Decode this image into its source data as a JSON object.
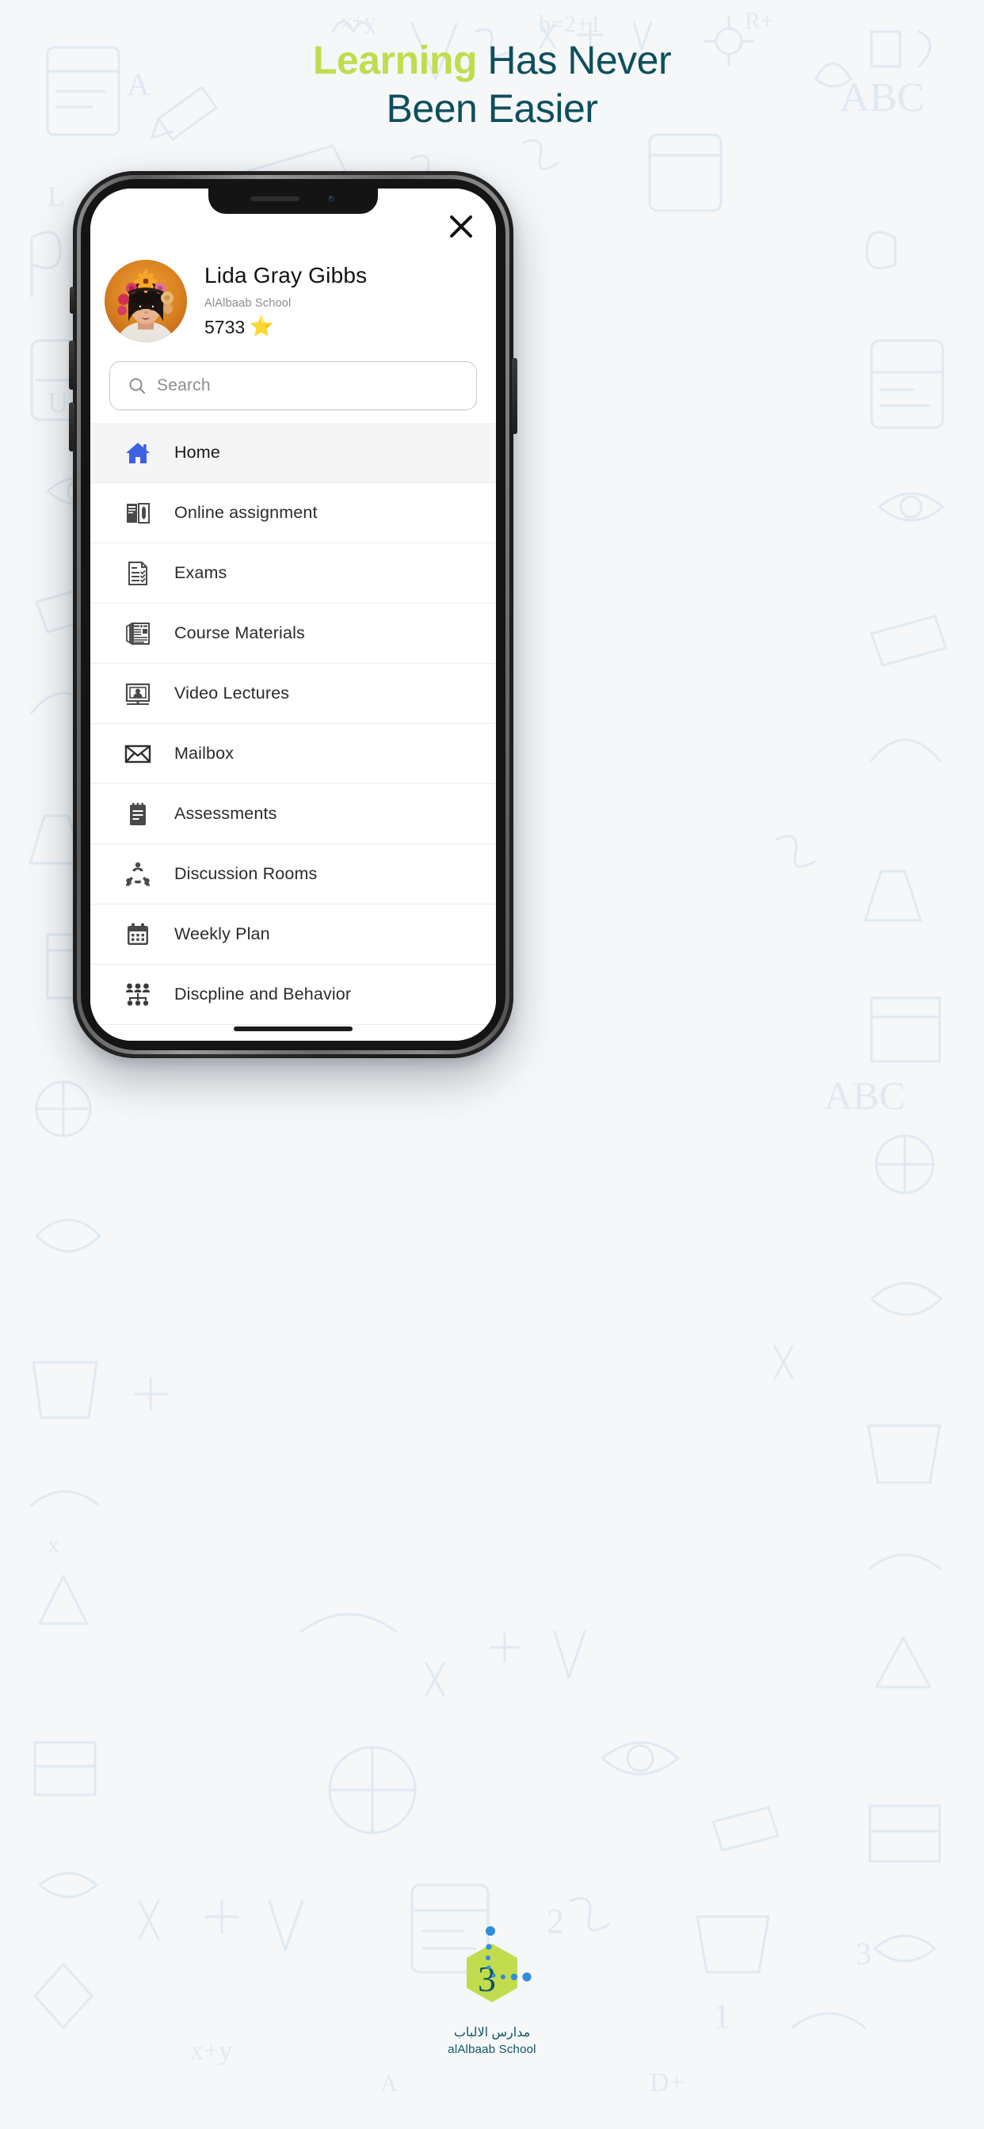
{
  "headline": {
    "accent_word": "Learning",
    "rest_line1": " Has Never",
    "line2": "Been Easier",
    "accent_color": "#c2dc4e",
    "text_color": "#0e4f5c"
  },
  "phone": {
    "close_icon": "close-icon"
  },
  "profile": {
    "name": "Lida Gray Gibbs",
    "school": "AlAlbaab School",
    "points": "5733",
    "star": "⭐",
    "avatar_alt": "user-avatar"
  },
  "search": {
    "placeholder": "Search",
    "icon": "search-icon"
  },
  "menu": {
    "items": [
      {
        "label": "Home",
        "icon": "home-icon",
        "active": true
      },
      {
        "label": "Online assignment",
        "icon": "assignment-book-icon",
        "active": false
      },
      {
        "label": "Exams",
        "icon": "exam-checklist-icon",
        "active": false
      },
      {
        "label": "Course Materials",
        "icon": "newspaper-icon",
        "active": false
      },
      {
        "label": "Video Lectures",
        "icon": "video-presenter-icon",
        "active": false
      },
      {
        "label": "Mailbox",
        "icon": "envelope-icon",
        "active": false
      },
      {
        "label": "Assessments",
        "icon": "notepad-icon",
        "active": false
      },
      {
        "label": "Discussion Rooms",
        "icon": "group-discussion-icon",
        "active": false
      },
      {
        "label": "Weekly Plan",
        "icon": "calendar-icon",
        "active": false
      },
      {
        "label": "Discpline and Behavior",
        "icon": "people-hierarchy-icon",
        "active": false
      }
    ],
    "active_icon_color": "#3d62e0",
    "icon_color": "#4a4a4a"
  },
  "footer": {
    "arabic_name": "مدارس الالباب",
    "english_name": "alAlbaab School",
    "logo_green": "#c2dc4e",
    "logo_blue": "#2f8ddb",
    "logo_text_color": "#0f5563"
  }
}
